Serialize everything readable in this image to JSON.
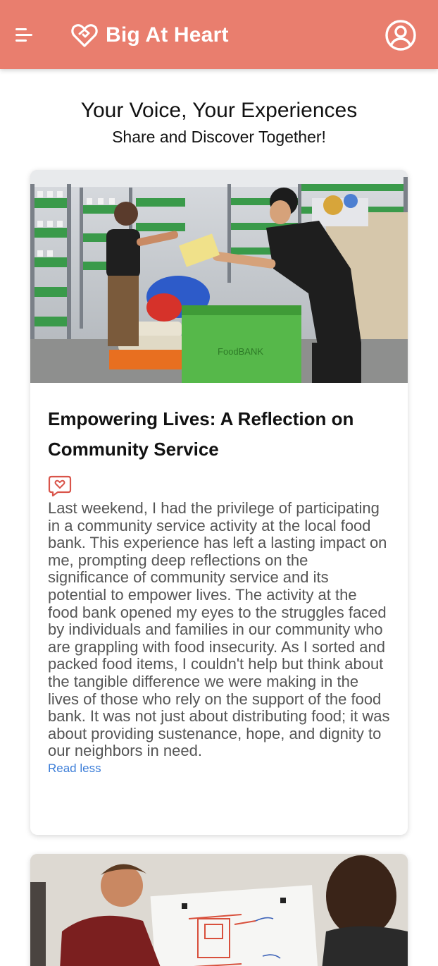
{
  "header": {
    "app_title": "Big At Heart",
    "bg_color": "#e97e6e",
    "menu_icon": "hamburger-menu-icon",
    "logo_icon": "heart-handshake-icon",
    "profile_icon": "user-circle-icon"
  },
  "hero": {
    "title": "Your Voice, Your Experiences",
    "subtitle": "Share and Discover Together!"
  },
  "posts": [
    {
      "image": "food-bank-volunteers-photo",
      "title": "Empowering Lives: A Reflection on Community Service",
      "reaction_icon": "heart-message-icon",
      "body": "Last weekend, I had the privilege of participating in a community service activity at the local food bank. This experience has left a lasting impact on me, prompting deep reflections on the significance of community service and its potential to empower lives. The activity at the food bank opened my eyes to the struggles faced by individuals and families in our community who are grappling with food insecurity. As I sorted and packed food items, I couldn't help but think about the tangible difference we were making in the lives of those who rely on the support of the food bank. It was not just about distributing food; it was about providing sustenance, hope, and dignity to our neighbors in need.",
      "toggle_label": "Read less"
    },
    {
      "image": "whiteboard-planning-photo"
    }
  ],
  "colors": {
    "accent": "#e97e6e",
    "link": "#3d7ed8",
    "body_text": "#555555"
  }
}
